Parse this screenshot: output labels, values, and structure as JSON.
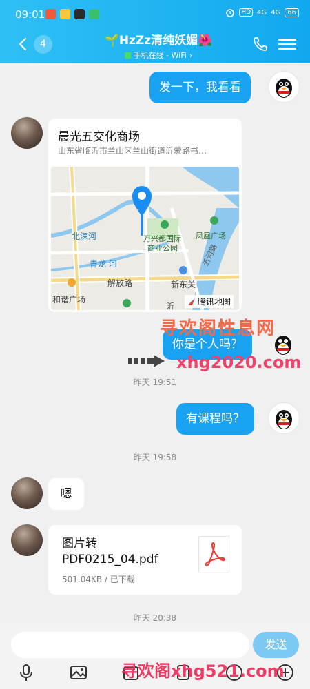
{
  "status_bar": {
    "time": "09:01",
    "network_1": "4G",
    "network_2": "4G",
    "hd_label": "HD",
    "battery": "66"
  },
  "header": {
    "unread_count": "4",
    "contact_name": "🌱HzZz清纯妖媚🌺",
    "online_status": "手机在线 - WiFi",
    "chevron": "›"
  },
  "messages": {
    "m1_text": "发一下，我看看",
    "location": {
      "title": "晨光五交化商场",
      "address": "山东省临沂市兰山区兰山街道沂蒙路书…",
      "map_labels": {
        "label_beisu": "北涑河",
        "label_qinglong": "青龙 河",
        "label_wanxing": "万兴都国际",
        "label_wanxing2": "商业公园",
        "label_fenghuang": "凤凰广场",
        "label_yihe": "沂河路",
        "label_jiefang": "解放路",
        "label_xindong": "新东关",
        "label_hexie": "和谐广场",
        "label_yi": "沂",
        "provider": "腾讯地图"
      }
    },
    "m2_text": "你是个人吗？",
    "time_1": "昨天 19:51",
    "m3_text": "有课程吗？",
    "time_2": "昨天 19:58",
    "m4_text": "嗯",
    "file": {
      "name": "图片转PDF0215_04.pdf",
      "meta": "501.04KB / 已下载"
    },
    "time_3": "昨天 20:38"
  },
  "input": {
    "placeholder": "",
    "send_label": "发送"
  },
  "watermarks": {
    "w1": "寻欢阁性息网",
    "w2": "xhg2020.com",
    "w3": "寻欢阁xhg521.com"
  },
  "colors": {
    "header": "#12a8ef",
    "bubble_me": "#1aa2f2",
    "send_button": "#7cc9f5",
    "online": "#4cd964"
  }
}
